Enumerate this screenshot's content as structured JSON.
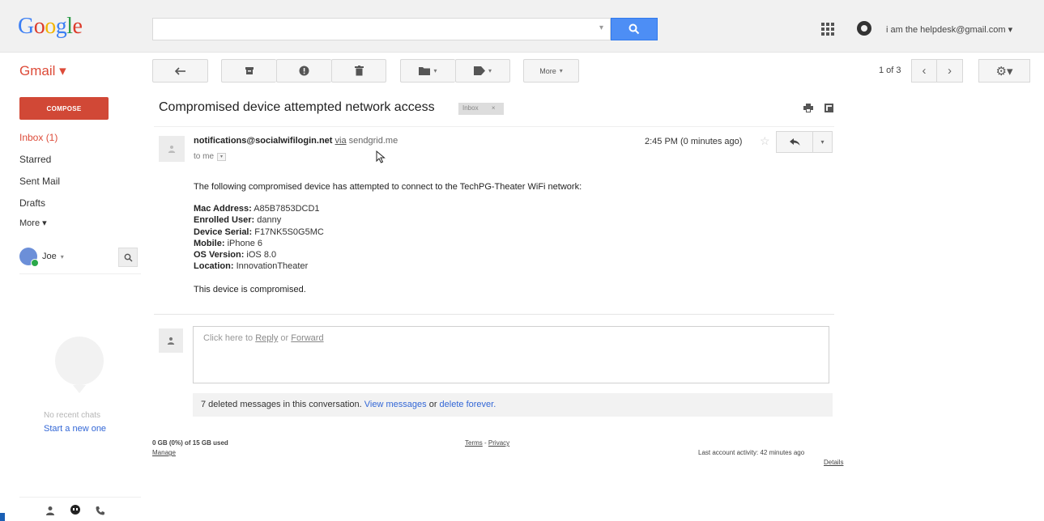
{
  "header": {
    "logo_text": [
      "G",
      "o",
      "o",
      "g",
      "l",
      "e"
    ],
    "search": {
      "value": "",
      "placeholder": ""
    },
    "account_email": "i am the helpdesk@gmail.com ▾"
  },
  "toolbar": {
    "app_label": "Gmail ▾",
    "more_label": "More",
    "pager_text": "1 of 3"
  },
  "sidebar": {
    "compose_label": "COMPOSE",
    "items": [
      {
        "label": "Inbox (1)",
        "active": true
      },
      {
        "label": "Starred",
        "active": false
      },
      {
        "label": "Sent Mail",
        "active": false
      },
      {
        "label": "Drafts",
        "active": false
      },
      {
        "label": "More ▾",
        "active": false
      }
    ],
    "chat_user": "Joe",
    "no_chats": "No recent chats",
    "start_new": "Start a new one"
  },
  "message": {
    "subject": "Compromised device attempted network access",
    "label_tag": "Inbox",
    "sender_email": "notifications@socialwifilogin.net",
    "via": "via",
    "via_domain": "sendgrid.me",
    "to": "to me",
    "time": "2:45 PM (0 minutes ago)",
    "intro": "The following compromised device has attempted to connect to the TechPG-Theater WiFi network:",
    "fields": [
      {
        "label": "Mac Address:",
        "value": "A85B7853DCD1"
      },
      {
        "label": "Enrolled User:",
        "value": "danny"
      },
      {
        "label": "Device Serial:",
        "value": "F17NK5S0G5MC"
      },
      {
        "label": "Mobile:",
        "value": "iPhone 6"
      },
      {
        "label": "OS Version:",
        "value": "iOS 8.0"
      },
      {
        "label": "Location:",
        "value": "InnovationTheater"
      }
    ],
    "closing": "This device is compromised."
  },
  "reply": {
    "prefix": "Click here to",
    "reply_link": "Reply",
    "or": "or",
    "forward_link": "Forward"
  },
  "deleted": {
    "text": "7 deleted messages in this conversation.",
    "view_link": "View messages",
    "or": "or",
    "delete_link": "delete forever."
  },
  "footer": {
    "storage": "0 GB (0%) of 15 GB used",
    "manage": "Manage",
    "terms": "Terms",
    "separator": "-",
    "privacy": "Privacy",
    "last_activity": "Last account activity: 42 minutes ago",
    "details": "Details"
  },
  "colors": {
    "compose": "#d14836",
    "search_button": "#4d8ef5",
    "link": "#3367d6",
    "gmail_red": "#dd4b39"
  }
}
